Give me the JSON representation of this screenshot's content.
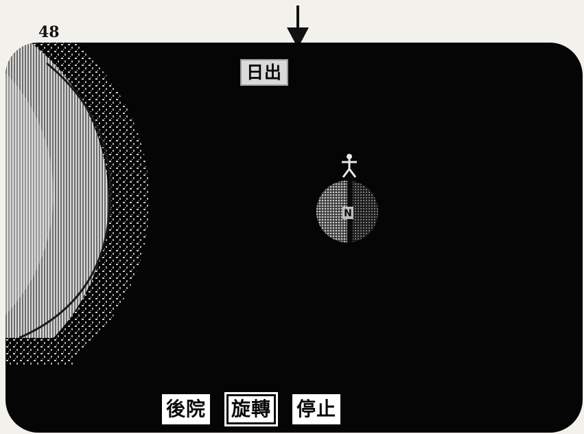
{
  "page": {
    "number": "48"
  },
  "screen": {
    "label_top": "日出",
    "compass_letter": "N",
    "buttons": [
      {
        "label": "後院",
        "selected": false
      },
      {
        "label": "旋轉",
        "selected": true
      },
      {
        "label": "停止",
        "selected": false
      }
    ]
  },
  "icons": {
    "pointer": "down-arrow-icon",
    "player": "stick-figure-icon",
    "planet": "planet-icon"
  },
  "colors": {
    "screen_background": "#050505",
    "label_background": "#d9d9d9",
    "button_background": "#ffffff"
  }
}
